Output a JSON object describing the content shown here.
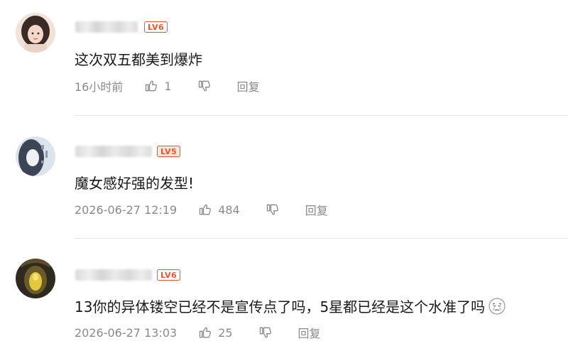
{
  "comments": [
    {
      "level": "LV6",
      "text": "这次双五都美到爆炸",
      "time": "16小时前",
      "likes": "1",
      "reply_label": "回复"
    },
    {
      "level": "LV5",
      "text": "魔女感好强的发型!",
      "time": "2026-06-27 12:19",
      "likes": "484",
      "reply_label": "回复"
    },
    {
      "level": "LV6",
      "text": "13你的异体镂空已经不是宣传点了吗，5星都已经是这个水准了吗",
      "time": "2026-06-27 13:03",
      "likes": "25",
      "reply_label": "回复"
    }
  ],
  "colors": {
    "level_badge": "#f0542c",
    "meta_text": "#8a8a8a",
    "divider": "#e6e6e6"
  },
  "icons": {
    "like": "thumbs-up-icon",
    "dislike": "thumbs-down-icon",
    "emoji": "crying-face-emoji-icon"
  }
}
